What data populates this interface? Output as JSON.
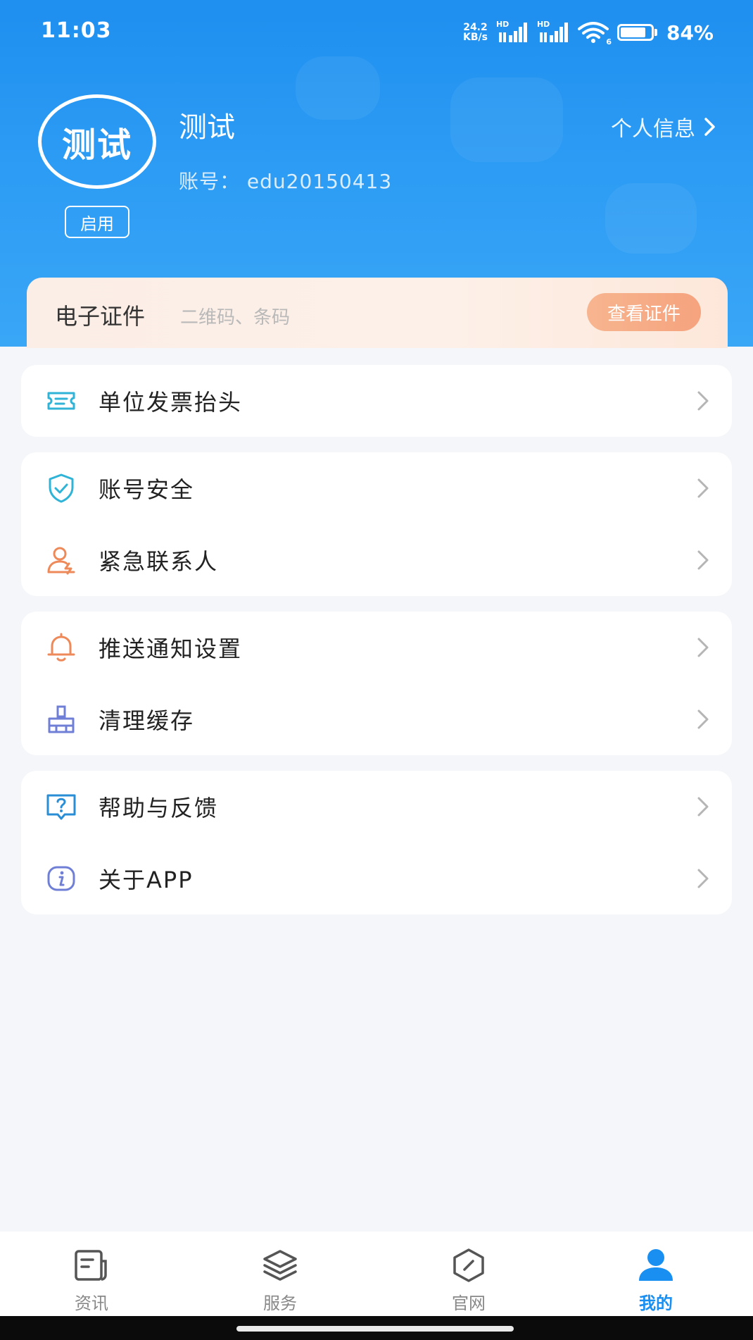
{
  "status_bar": {
    "time": "11:03",
    "net_speed_value": "24.2",
    "net_speed_unit": "KB/s",
    "sim1_label": "HD",
    "sim2_label": "HD",
    "wifi_sub": "6",
    "battery_percent": "84%",
    "battery_level": 0.84
  },
  "profile": {
    "avatar_text": "测试",
    "status_tag": "启用",
    "name": "测试",
    "account_line": "账号： edu20150413",
    "profile_link": "个人信息"
  },
  "cert": {
    "title": "电子证件",
    "subtitle": "二维码、条码",
    "button": "查看证件"
  },
  "menu": {
    "invoice": "单位发票抬头",
    "security": "账号安全",
    "emergency": "紧急联系人",
    "push": "推送通知设置",
    "cache": "清理缓存",
    "help": "帮助与反馈",
    "about": "关于APP"
  },
  "icons": {
    "invoice": "ticket-icon",
    "security": "shield-check-icon",
    "emergency": "contact-person-icon",
    "push": "bell-icon",
    "cache": "broom-icon",
    "help": "help-chat-icon",
    "about": "info-icon"
  },
  "tabs": [
    {
      "label": "资讯",
      "icon": "news-icon",
      "active": false
    },
    {
      "label": "服务",
      "icon": "layers-icon",
      "active": false
    },
    {
      "label": "官网",
      "icon": "compass-icon",
      "active": false
    },
    {
      "label": "我的",
      "icon": "user-icon",
      "active": true
    }
  ],
  "colors": {
    "header_blue": "#1f8ff0",
    "accent_blue": "#1a8ff2",
    "cert_button": "#f5a37e",
    "icon_teal": "#2fb3d6",
    "icon_orange": "#ee8a5a",
    "icon_indigo": "#6f7fd6"
  }
}
